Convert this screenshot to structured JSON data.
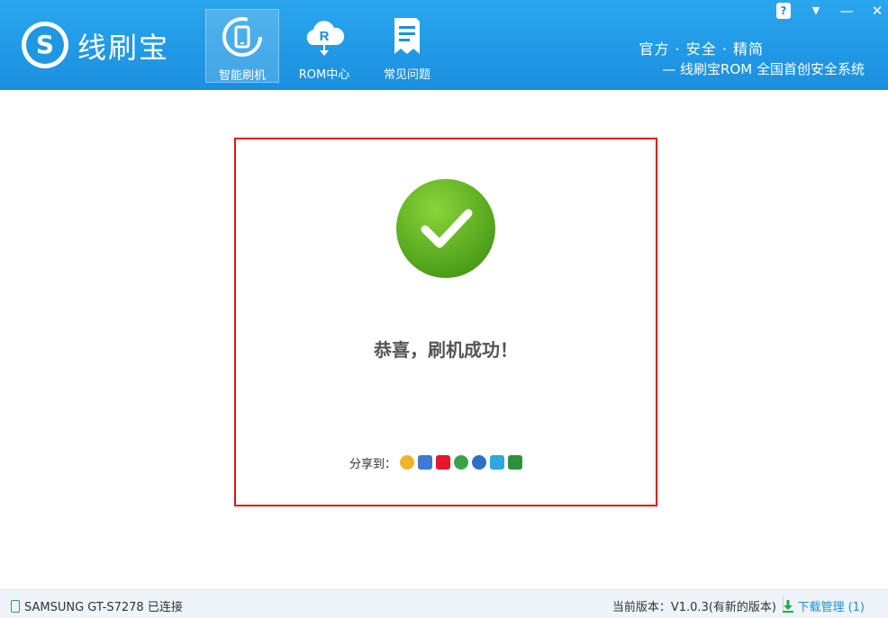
{
  "app": {
    "logo_glyph": "S",
    "logo_text": "线刷宝",
    "nav": [
      {
        "label": "智能刷机",
        "icon": "phone-refresh-icon",
        "active": true
      },
      {
        "label": "ROM中心",
        "icon": "rom-cloud-icon",
        "active": false
      },
      {
        "label": "常见问题",
        "icon": "document-icon",
        "active": false
      }
    ],
    "slogan_line1": "官方 · 安全 · 精简",
    "slogan_line2": "— 线刷宝ROM 全国首创安全系统",
    "window_controls": [
      {
        "glyph": "?",
        "icon": "help-icon"
      },
      {
        "glyph": "▼",
        "icon": "menu-icon"
      },
      {
        "glyph": "—",
        "icon": "minimize-icon"
      },
      {
        "glyph": "✕",
        "icon": "close-icon"
      }
    ]
  },
  "main": {
    "success_icon": "checkmark-icon",
    "message": "恭喜，刷机成功！",
    "share_label": "分享到：",
    "share_targets": [
      {
        "icon": "qzone-icon",
        "color": "#f0b429"
      },
      {
        "icon": "qq-icon",
        "color": "#3a7bd5"
      },
      {
        "icon": "weibo-icon",
        "color": "#e6162d"
      },
      {
        "icon": "clover-icon",
        "color": "#3aa34a"
      },
      {
        "icon": "renren-icon",
        "color": "#2f6ec8"
      },
      {
        "icon": "pengyou-icon",
        "color": "#2fa7e0"
      },
      {
        "icon": "douban-icon",
        "color": "#2f8f3a"
      }
    ]
  },
  "footer": {
    "device": "SAMSUNG GT-S7278 已连接",
    "version": "当前版本：V1.0.3(有新的版本)",
    "download_label": "下载管理 (1)"
  },
  "colors": {
    "header_blue": "#1b8fdf",
    "panel_border": "#e01515",
    "check_green": "#4fa11a"
  }
}
